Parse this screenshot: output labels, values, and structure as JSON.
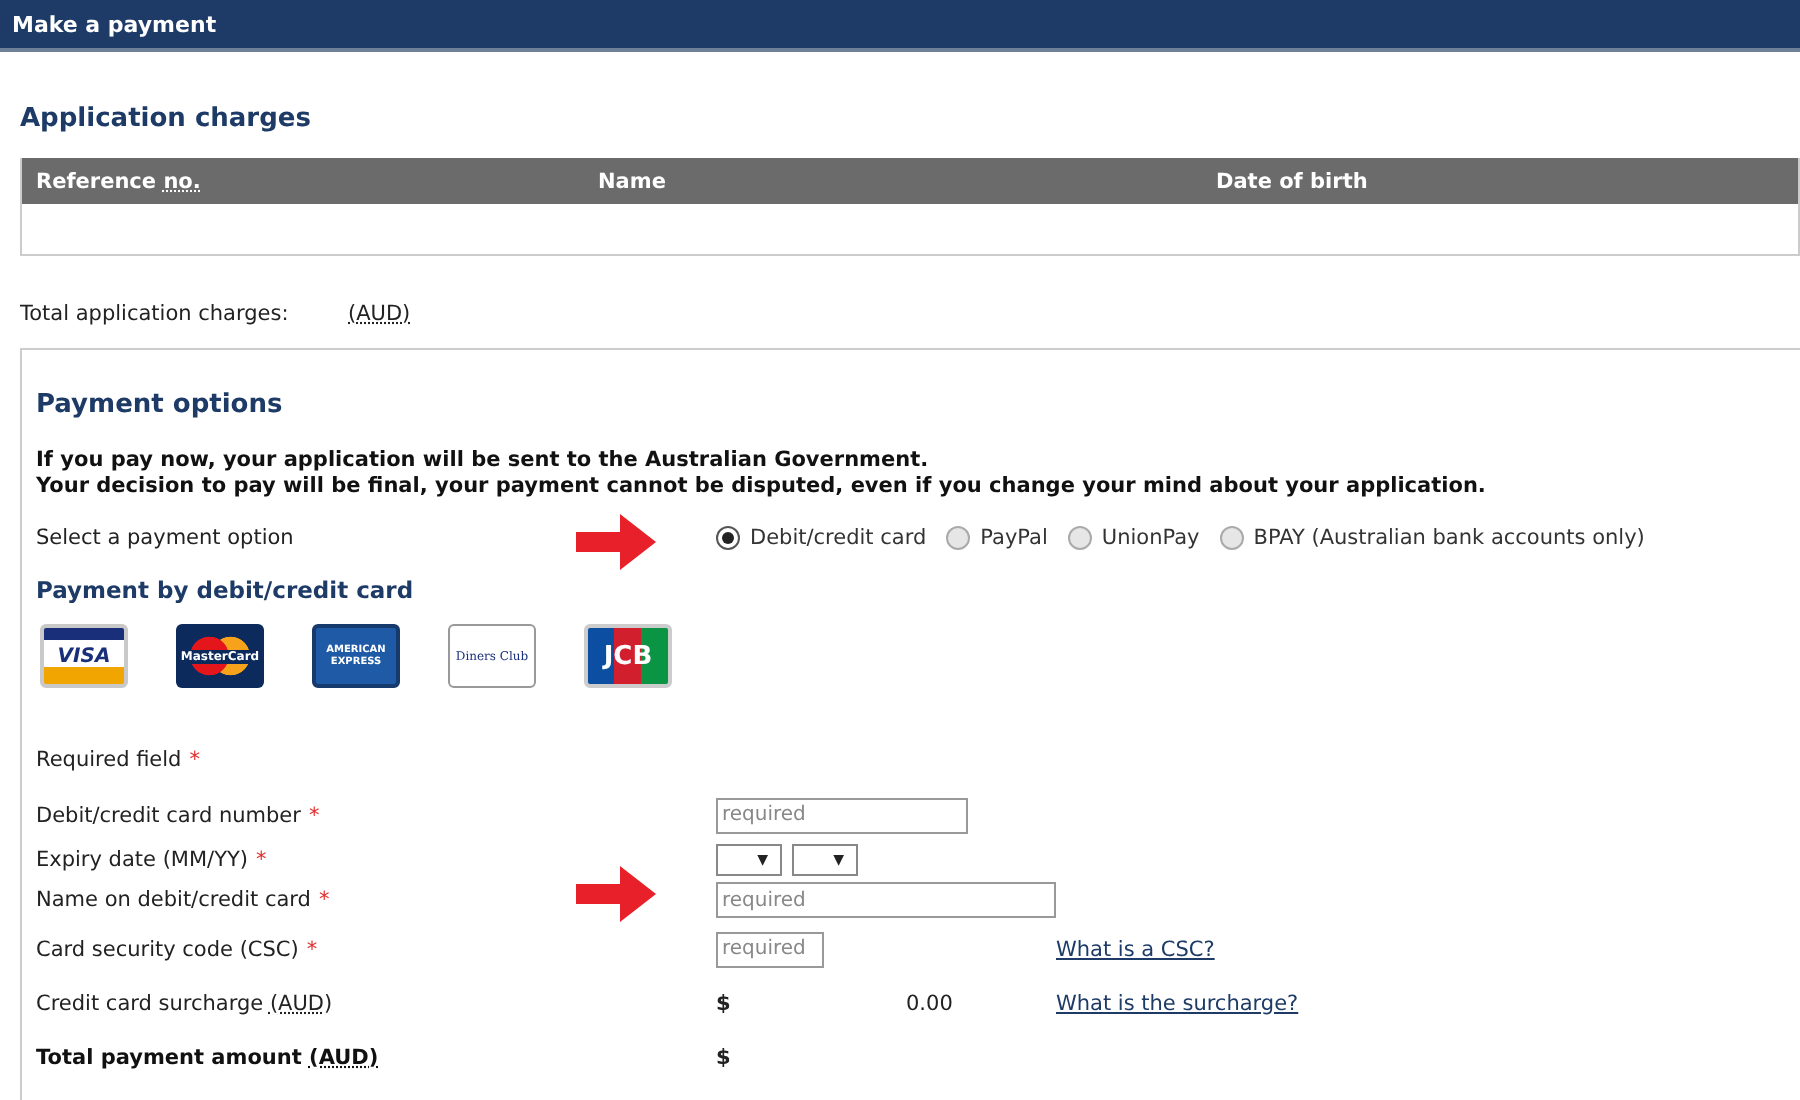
{
  "header": {
    "title": "Make a payment"
  },
  "charges": {
    "title": "Application charges",
    "columns": [
      {
        "label": "Reference",
        "abbr": "no."
      },
      {
        "label": "Name"
      },
      {
        "label": "Date of birth"
      }
    ],
    "total_label": "Total application charges:",
    "total_unit": "(AUD)"
  },
  "payment": {
    "title": "Payment options",
    "notice": [
      "If you pay now, your application will be sent to the Australian Government.",
      "Your decision to pay will be final, your payment cannot be disputed, even if you change your mind about your application."
    ],
    "option_label": "Select a payment option",
    "options": [
      {
        "label": "Debit/credit card",
        "selected": true
      },
      {
        "label": "PayPal",
        "selected": false
      },
      {
        "label": "UnionPay",
        "selected": false
      },
      {
        "label": "BPAY (Australian bank accounts only)",
        "selected": false
      }
    ],
    "card_title": "Payment by debit/credit card",
    "cards": [
      {
        "kind": "visa",
        "label": "VISA"
      },
      {
        "kind": "mastercard",
        "label": "MasterCard"
      },
      {
        "kind": "amex",
        "label": "AMERICAN EXPRESS"
      },
      {
        "kind": "diners",
        "label": "Diners Club"
      },
      {
        "kind": "jcb",
        "label": "JCB"
      }
    ],
    "required_mark": "*",
    "required_note": "Required field",
    "fields": [
      {
        "kind": "input",
        "label": "Debit/credit card number",
        "required": true,
        "placeholder": "required"
      },
      {
        "kind": "selects",
        "label": "Expiry date (MM/YY)",
        "required": true,
        "selects": [
          "▼",
          "▼"
        ]
      },
      {
        "kind": "input",
        "label": "Name on debit/credit card",
        "required": true,
        "placeholder": "required"
      },
      {
        "kind": "input",
        "label": "Card security code (CSC)",
        "required": true,
        "placeholder": "required",
        "link": "What is a CSC?"
      },
      {
        "kind": "amount",
        "label": "Credit card surcharge",
        "unit": "(AUD)",
        "required": false,
        "currency": "$",
        "value": "0.00",
        "link": "What is the surcharge?"
      },
      {
        "kind": "total",
        "label": "Total payment amount",
        "unit": "(AUD)",
        "required": false,
        "currency": "$"
      }
    ]
  }
}
